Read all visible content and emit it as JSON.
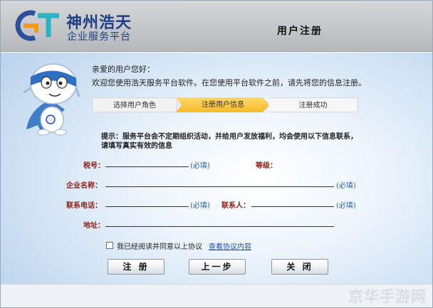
{
  "header": {
    "brand_name": "神州浩天",
    "brand_sub": "企业服务平台",
    "page_title": "用户注册",
    "logo_text": "GT"
  },
  "intro": {
    "greeting": "亲爱的用户您好：",
    "welcome": "欢迎您使用浩天服务平台软件。在您使用平台软件之前，请先将您的信息注册。"
  },
  "steps": [
    {
      "label": "选择用户角色",
      "active": false
    },
    {
      "label": "注册用户信息",
      "active": true
    },
    {
      "label": "注册成功",
      "active": false
    }
  ],
  "notice": {
    "line1": "提示：服务平台会不定期组织活动，并给用户发放福利，均会使用以下信息联系，",
    "line2": "请填写真实有效的信息"
  },
  "form": {
    "tax_no": {
      "label": "税号：",
      "value": "",
      "required": "(必填)"
    },
    "level": {
      "label": "等级：",
      "value": ""
    },
    "company": {
      "label": "企业名称：",
      "value": "",
      "required": "(必填)"
    },
    "phone": {
      "label": "联系电话：",
      "value": "",
      "required": "(必填)"
    },
    "contact": {
      "label": "联系人：",
      "value": "",
      "required": "(必填)"
    },
    "address": {
      "label": "地址：",
      "value": ""
    }
  },
  "agreement": {
    "checkbox_label": "我已经阅读并同意以上协议",
    "checked": false,
    "link_text": "查看协议内容"
  },
  "buttons": {
    "register": "注 册",
    "back": "上一步",
    "close": "关 闭"
  },
  "watermark": "京华手游网",
  "colors": {
    "brand": "#1e3f86",
    "label": "#8a1e12",
    "required": "#2a5fb0",
    "active_step": "#f7b92a"
  }
}
